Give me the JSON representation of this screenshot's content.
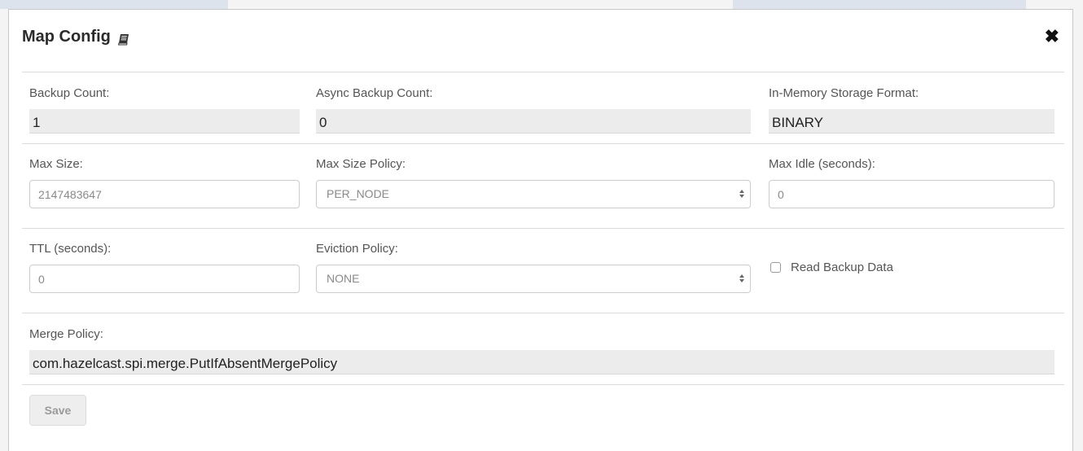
{
  "dialog": {
    "title": "Map Config",
    "close_glyph": "✖"
  },
  "fields": {
    "backup_count": {
      "label": "Backup Count:",
      "value": "1"
    },
    "async_backup_count": {
      "label": "Async Backup Count:",
      "value": "0"
    },
    "in_memory_format": {
      "label": "In-Memory Storage Format:",
      "value": "BINARY"
    },
    "max_size": {
      "label": "Max Size:",
      "placeholder": "2147483647"
    },
    "max_size_policy": {
      "label": "Max Size Policy:",
      "value": "PER_NODE"
    },
    "max_idle": {
      "label": "Max Idle (seconds):",
      "placeholder": "0"
    },
    "ttl": {
      "label": "TTL (seconds):",
      "placeholder": "0"
    },
    "eviction_policy": {
      "label": "Eviction Policy:",
      "value": "NONE"
    },
    "read_backup_data": {
      "label": "Read Backup Data",
      "checked": false
    },
    "merge_policy": {
      "label": "Merge Policy:",
      "value": "com.hazelcast.spi.merge.PutIfAbsentMergePolicy"
    }
  },
  "actions": {
    "save_label": "Save"
  },
  "icons": {
    "title_icon": "book-icon",
    "close_icon": "close-icon",
    "select_arrows": "select-arrows-icon"
  }
}
